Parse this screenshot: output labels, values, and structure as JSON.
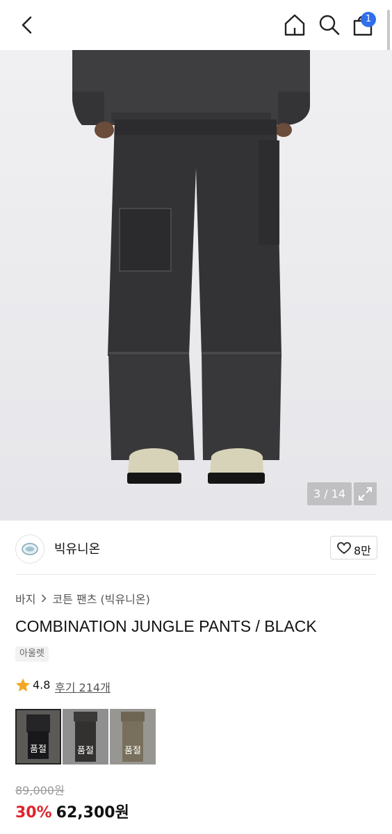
{
  "header": {
    "cart_count": "1",
    "icons": [
      "back-icon",
      "home-icon",
      "search-icon",
      "shopping-bag-icon"
    ]
  },
  "gallery": {
    "counter": "3 / 14",
    "current": 3,
    "total": 14
  },
  "brand": {
    "name": "빅유니온",
    "likes": "8만"
  },
  "breadcrumb": {
    "category": "바지",
    "subcategory": "코튼 팬츠 (빅유니온)"
  },
  "product": {
    "title": "COMBINATION JUNGLE PANTS / BLACK",
    "tag": "아울렛",
    "rating": "4.8",
    "reviews": "후기 214개",
    "variants": [
      {
        "label": "품절",
        "color": "#2f2f31",
        "selected": true
      },
      {
        "label": "품절",
        "color": "#585652",
        "selected": false
      },
      {
        "label": "품절",
        "color": "#b9ad8e",
        "selected": false
      }
    ],
    "original_price": "89,000원",
    "discount": "30%",
    "price": "62,300원"
  },
  "colors": {
    "accent_red": "#e0242c",
    "badge_blue": "#2f6fed",
    "star": "#f5a623"
  }
}
